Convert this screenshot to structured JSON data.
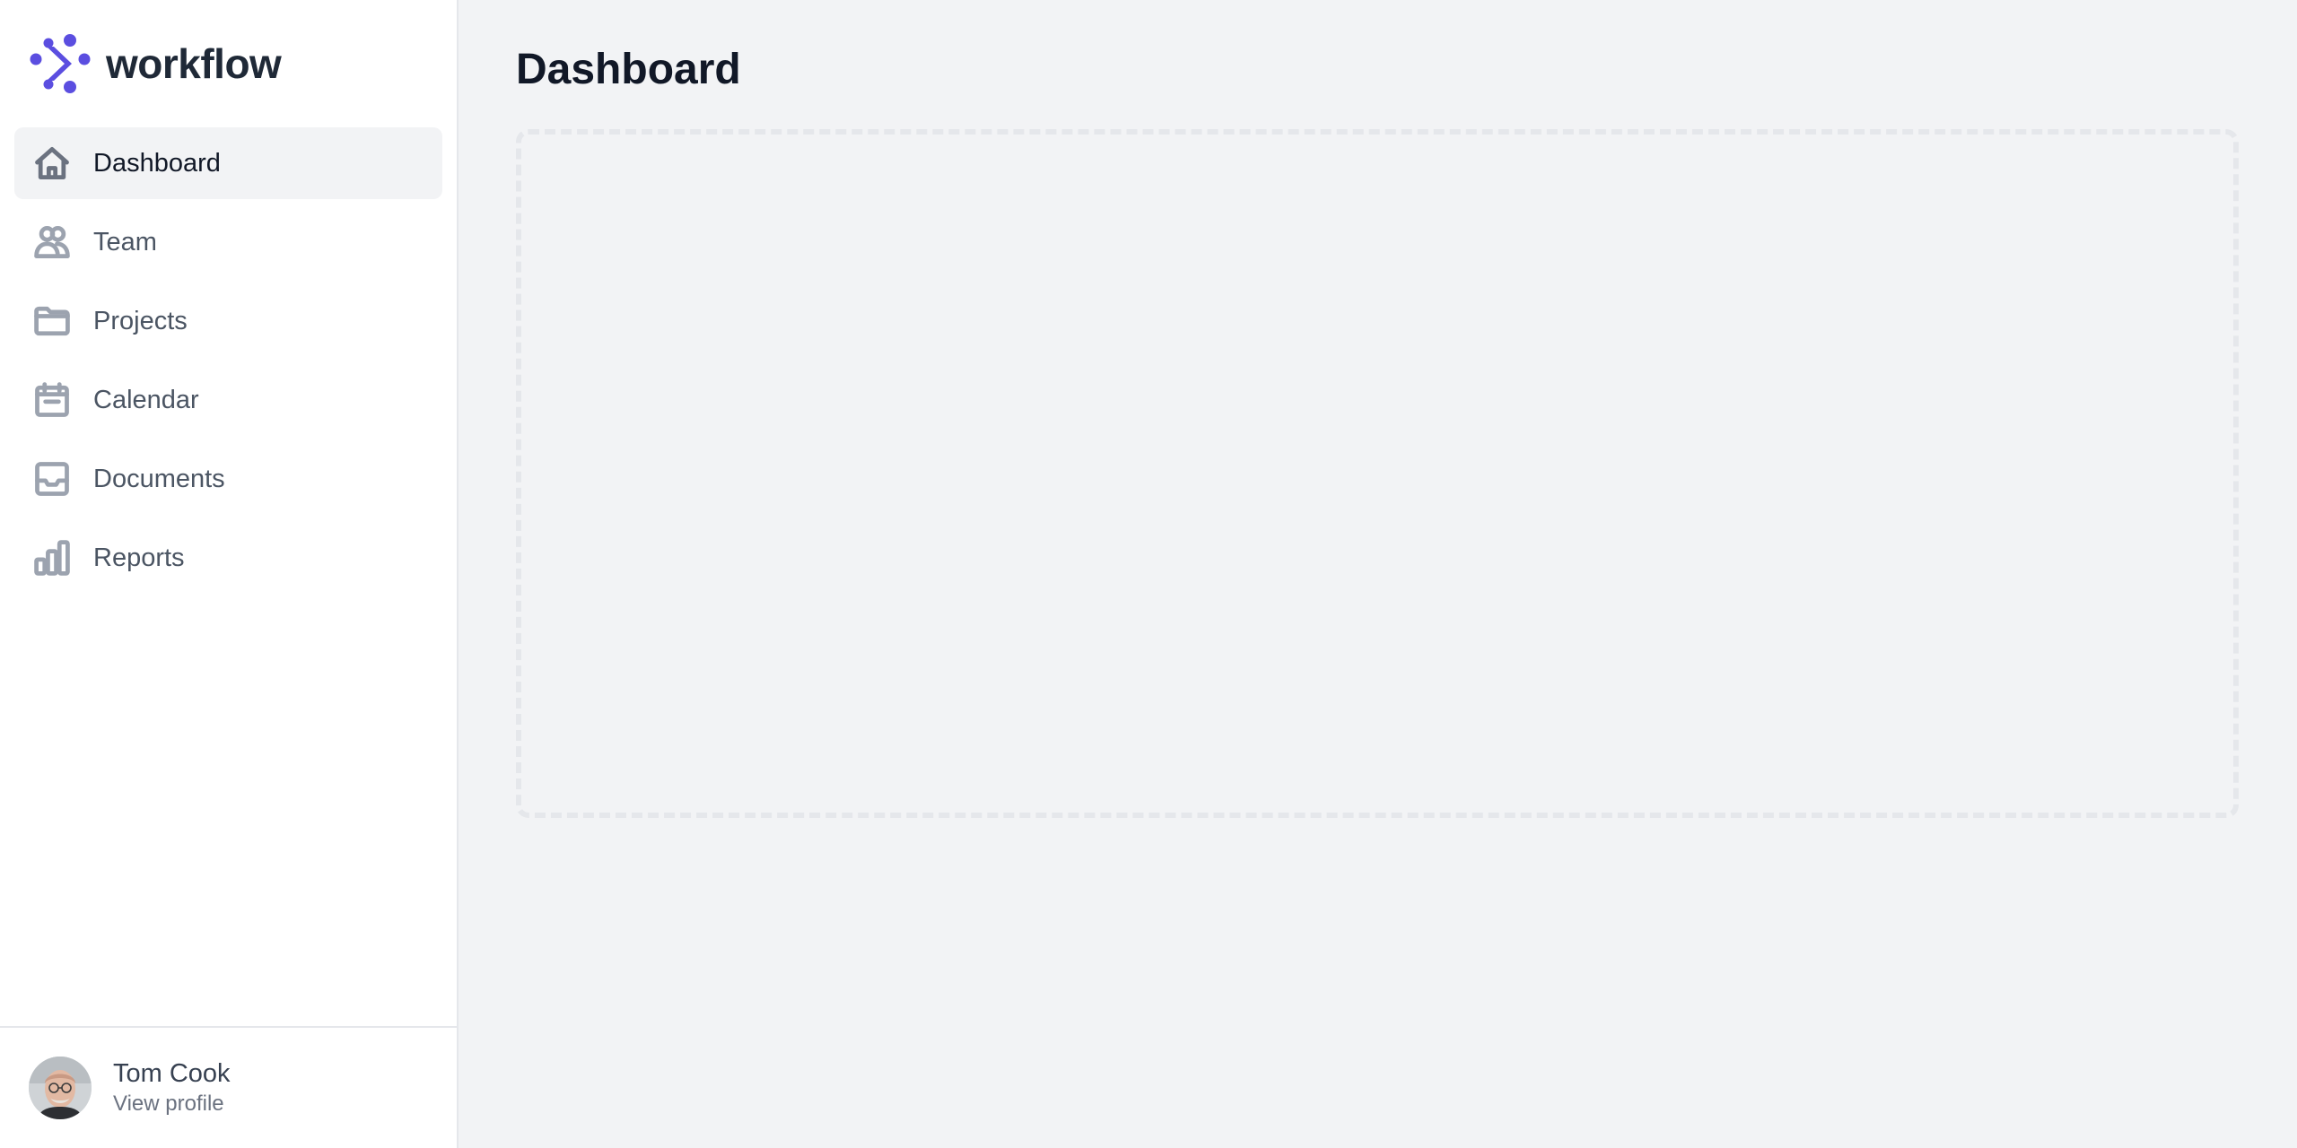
{
  "brand": {
    "name": "workflow",
    "logo_icon": "workflow-logo-icon",
    "accent_color": "#5b4ee0"
  },
  "sidebar": {
    "items": [
      {
        "label": "Dashboard",
        "icon": "home-icon",
        "active": true
      },
      {
        "label": "Team",
        "icon": "users-icon",
        "active": false
      },
      {
        "label": "Projects",
        "icon": "folder-icon",
        "active": false
      },
      {
        "label": "Calendar",
        "icon": "calendar-icon",
        "active": false
      },
      {
        "label": "Documents",
        "icon": "inbox-icon",
        "active": false
      },
      {
        "label": "Reports",
        "icon": "chart-bar-icon",
        "active": false
      }
    ]
  },
  "profile": {
    "name": "Tom Cook",
    "link_label": "View profile"
  },
  "main": {
    "title": "Dashboard"
  }
}
